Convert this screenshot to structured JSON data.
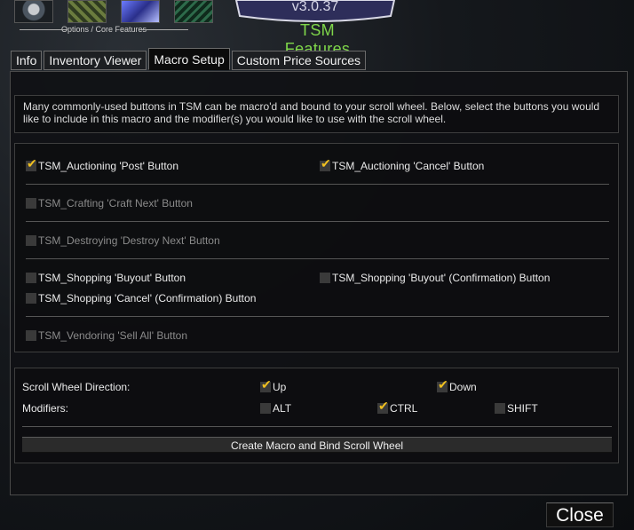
{
  "header": {
    "options_caption": "Options / Core Features",
    "logo_title": "TSM Features",
    "version_text": "v3.0.37"
  },
  "tabs": [
    {
      "label": "Info"
    },
    {
      "label": "Inventory Viewer"
    },
    {
      "label": "Macro Setup",
      "active": true
    },
    {
      "label": "Custom Price Sources"
    }
  ],
  "description": "Many commonly-used buttons in TSM can be macro'd and bound to your scroll wheel. Below, select the buttons you would like to include in this macro and the modifier(s) you would like to use with the scroll wheel.",
  "macro_buttons": {
    "auctioning_post": {
      "label": "TSM_Auctioning 'Post' Button",
      "checked": true,
      "enabled": true
    },
    "auctioning_cancel": {
      "label": "TSM_Auctioning 'Cancel' Button",
      "checked": true,
      "enabled": true
    },
    "crafting_next": {
      "label": "TSM_Crafting 'Craft Next' Button",
      "checked": false,
      "enabled": false
    },
    "destroying_next": {
      "label": "TSM_Destroying 'Destroy Next' Button",
      "checked": false,
      "enabled": false
    },
    "shopping_buyout": {
      "label": "TSM_Shopping 'Buyout' Button",
      "checked": false,
      "enabled": true
    },
    "shopping_buyout_confirm": {
      "label": "TSM_Shopping 'Buyout' (Confirmation) Button",
      "checked": false,
      "enabled": true
    },
    "shopping_cancel_confirm": {
      "label": "TSM_Shopping 'Cancel' (Confirmation) Button",
      "checked": false,
      "enabled": true
    },
    "vendoring_sell_all": {
      "label": "TSM_Vendoring 'Sell All' Button",
      "checked": false,
      "enabled": false
    }
  },
  "scroll": {
    "direction_label": "Scroll Wheel Direction:",
    "up": {
      "label": "Up",
      "checked": true
    },
    "down": {
      "label": "Down",
      "checked": true
    },
    "modifiers_label": "Modifiers:",
    "alt": {
      "label": "ALT",
      "checked": false
    },
    "ctrl": {
      "label": "CTRL",
      "checked": true
    },
    "shift": {
      "label": "SHIFT",
      "checked": false
    }
  },
  "create_button_label": "Create Macro and Bind Scroll Wheel",
  "close_button_label": "Close",
  "colors": {
    "accent_green": "#7fd64a",
    "check_gold": "#f0c020"
  }
}
